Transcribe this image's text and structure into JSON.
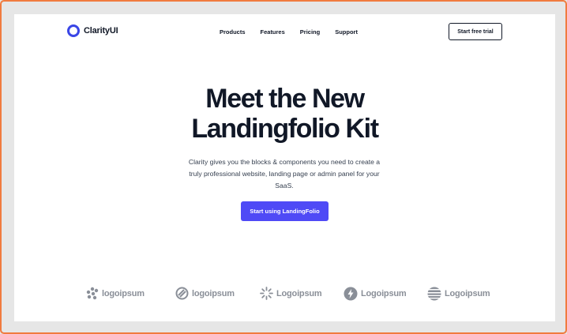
{
  "header": {
    "brand": "ClarityUI",
    "nav": [
      {
        "label": "Products"
      },
      {
        "label": "Features"
      },
      {
        "label": "Pricing"
      },
      {
        "label": "Support"
      }
    ],
    "cta": "Start free trial"
  },
  "hero": {
    "title_line1": "Meet the New",
    "title_line2": "Landingfolio Kit",
    "subtitle": "Clarity gives you the blocks & components you need to create a truly professional website, landing page or admin panel for your SaaS.",
    "cta": "Start using LandingFolio"
  },
  "logos": [
    {
      "name": "logoipsum",
      "icon": "dots-cluster-icon"
    },
    {
      "name": "logoipsum",
      "icon": "slashed-circle-icon"
    },
    {
      "name": "Logoipsum",
      "icon": "sunburst-icon"
    },
    {
      "name": "Logoipsum",
      "icon": "lightning-circle-icon"
    },
    {
      "name": "Logoipsum",
      "icon": "striped-sphere-icon"
    }
  ],
  "colors": {
    "accent": "#4f4af6",
    "brand_ring": "#3a46e6",
    "text_dark": "#111827",
    "logo_gray": "#8a8f98",
    "frame_border": "#f07b3f"
  }
}
